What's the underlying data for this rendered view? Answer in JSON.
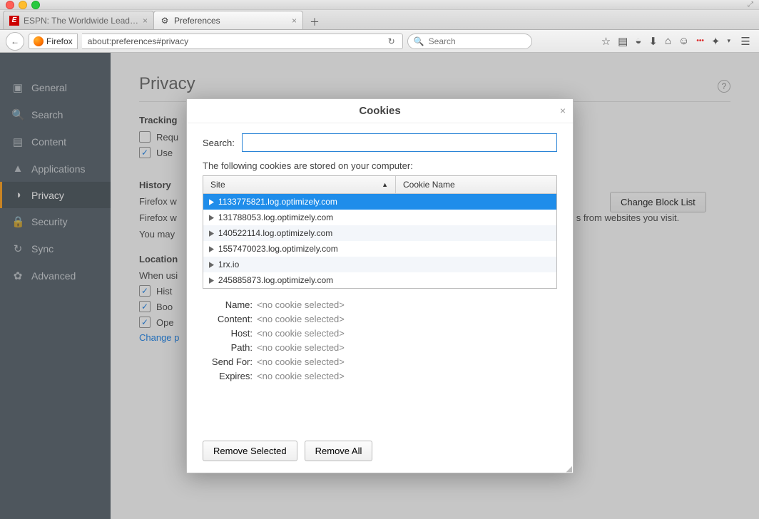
{
  "window": {
    "traffic": [
      "close",
      "min",
      "zoom"
    ]
  },
  "tabs": [
    {
      "title": "ESPN: The Worldwide Lead…",
      "active": false,
      "icon": "E"
    },
    {
      "title": "Preferences",
      "active": true,
      "icon": "gear"
    }
  ],
  "navbar": {
    "identity": "Firefox",
    "url": "about:preferences#privacy",
    "search_placeholder": "Search"
  },
  "toolbar_icons": [
    "star",
    "readlist",
    "pocket",
    "download",
    "home",
    "chat",
    "dots",
    "link",
    "dropdown",
    "menu"
  ],
  "sidebar": {
    "items": [
      {
        "label": "General",
        "icon": "general"
      },
      {
        "label": "Search",
        "icon": "search"
      },
      {
        "label": "Content",
        "icon": "content"
      },
      {
        "label": "Applications",
        "icon": "apps"
      },
      {
        "label": "Privacy",
        "icon": "mask"
      },
      {
        "label": "Security",
        "icon": "lock"
      },
      {
        "label": "Sync",
        "icon": "sync"
      },
      {
        "label": "Advanced",
        "icon": "adv"
      }
    ],
    "active_index": 4
  },
  "main": {
    "title": "Privacy",
    "tracking": {
      "heading": "Tracking",
      "row1": "Requ",
      "row2": "Use "
    },
    "change_block_list": "Change Block List",
    "history": {
      "heading": "History",
      "line1": "Firefox w",
      "line2": "Firefox w",
      "after2": "s from websites you visit.",
      "line3": "You may "
    },
    "location": {
      "heading": "Location",
      "sub": "When usi",
      "opts": [
        "Hist",
        "Boo",
        "Ope"
      ],
      "link": "Change p"
    }
  },
  "modal": {
    "title": "Cookies",
    "search_label": "Search:",
    "description": "The following cookies are stored on your computer:",
    "columns": {
      "site": "Site",
      "cookie": "Cookie Name"
    },
    "rows": [
      "1133775821.log.optimizely.com",
      "131788053.log.optimizely.com",
      "140522114.log.optimizely.com",
      "1557470023.log.optimizely.com",
      "1rx.io",
      "245885873.log.optimizely.com"
    ],
    "selected_index": 0,
    "details": {
      "Name": "<no cookie selected>",
      "Content": "<no cookie selected>",
      "Host": "<no cookie selected>",
      "Path": "<no cookie selected>",
      "Send For": "<no cookie selected>",
      "Expires": "<no cookie selected>"
    },
    "buttons": {
      "remove_selected": "Remove Selected",
      "remove_all": "Remove All"
    }
  }
}
